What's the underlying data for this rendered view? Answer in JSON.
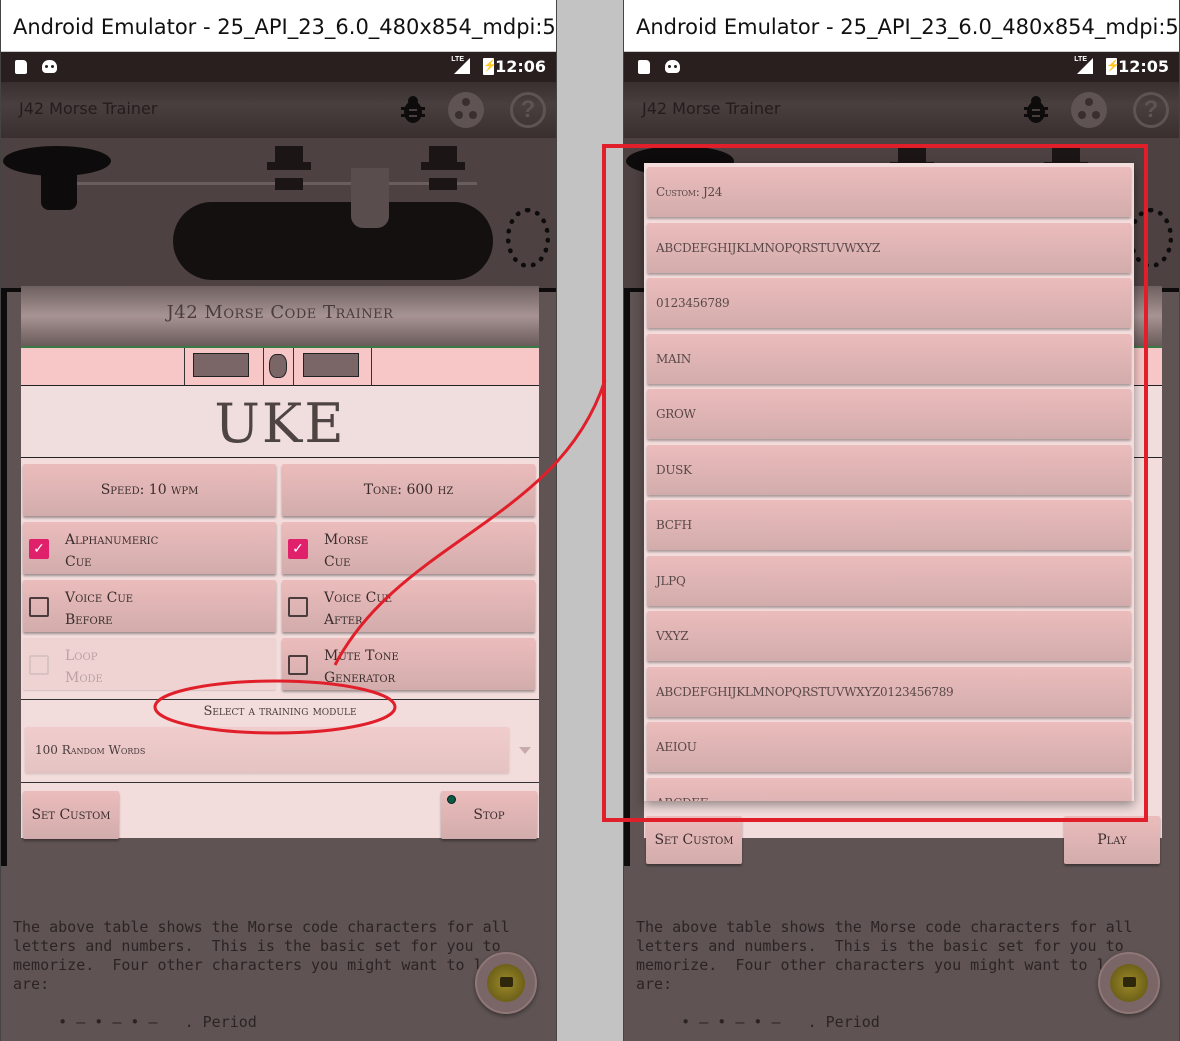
{
  "left_window": {
    "title": "Android Emulator - 25_API_23_6.0_480x854_mdpi:5554",
    "status_bar": {
      "lte_label": "LTE",
      "battery_glyph": "⚡",
      "time": "12:06",
      "icons": [
        "sd-card-icon",
        "android-debug-icon",
        "lte-signal-icon",
        "battery-charging-icon"
      ]
    },
    "app_bar": {
      "title": "J42 Morse Trainer",
      "actions": [
        "bug-icon",
        "dots-circle-icon",
        "help-icon"
      ],
      "help_glyph": "?"
    },
    "trainer": {
      "header": "J42 Morse Code Trainer",
      "current_word": "UKE",
      "speed_button": "Speed: 10 wpm",
      "tone_button": "Tone: 600 hz",
      "options": [
        {
          "line1": "Alphanumeric",
          "line2": "Cue",
          "checked": true,
          "enabled": true,
          "check_glyph": "✓"
        },
        {
          "line1": "Morse",
          "line2": "Cue",
          "checked": true,
          "enabled": true,
          "check_glyph": "✓"
        },
        {
          "line1": "Voice Cue",
          "line2": "Before",
          "checked": false,
          "enabled": true,
          "check_glyph": ""
        },
        {
          "line1": "Voice Cue",
          "line2": "After",
          "checked": false,
          "enabled": true,
          "check_glyph": ""
        },
        {
          "line1": "Loop",
          "line2": "Mode",
          "checked": false,
          "enabled": false,
          "check_glyph": ""
        },
        {
          "line1": "Mute Tone",
          "line2": "Generator",
          "checked": false,
          "enabled": true,
          "check_glyph": ""
        }
      ],
      "module_label": "Select a training module",
      "module_selected": "100 Random Words",
      "set_custom_button": "Set Custom",
      "play_stop_button": "Stop"
    },
    "description": "The above table shows the Morse code characters for all\nletters and numbers.  This is the basic set for you to\nmemorize.  Four other characters you might want to learn\nare:\n\n     • – • – • –   . Period",
    "fab_icon": "video-camera-icon"
  },
  "right_window": {
    "title": "Android Emulator - 25_API_23_6.0_480x854_mdpi:5554",
    "status_bar": {
      "lte_label": "LTE",
      "battery_glyph": "⚡",
      "time": "12:05"
    },
    "app_bar": {
      "title": "J42 Morse Trainer",
      "help_glyph": "?"
    },
    "trainer": {
      "header": "J42 Morse Code Trainer",
      "set_custom_button": "Set Custom",
      "play_stop_button": "Play"
    },
    "dropdown_options": [
      "Custom: J24",
      "ABCDEFGHIJKLMNOPQRSTUVWXYZ",
      "0123456789",
      "MAIN",
      "GROW",
      "DUSK",
      "BCFH",
      "JLPQ",
      "VXYZ",
      "ABCDEFGHIJKLMNOPQRSTUVWXYZ0123456789",
      "AEIOU",
      "ABCDEF"
    ],
    "description": "The above table shows the Morse code characters for all\nletters and numbers.  This is the basic set for you to\nmemorize.  Four other characters you might want to learn\nare:\n\n     • – • – • –   . Period"
  },
  "annotation": {
    "color": "#e11f2a"
  }
}
